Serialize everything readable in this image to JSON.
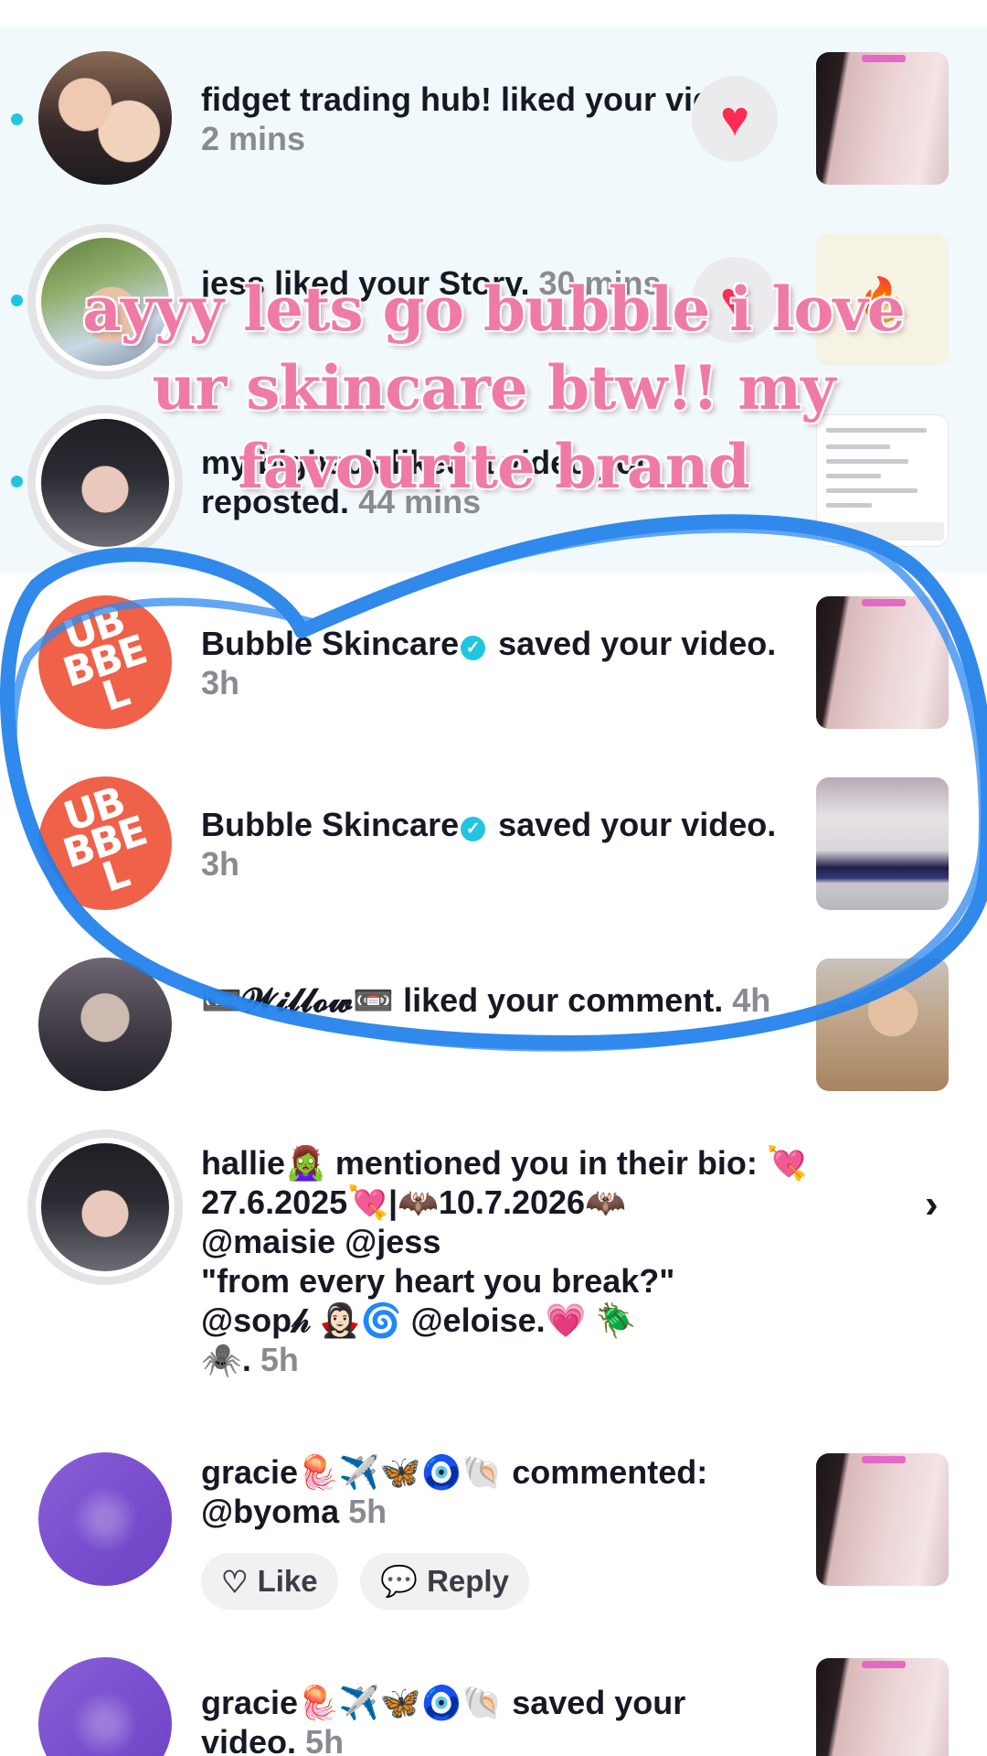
{
  "notifications": [
    {
      "user": "fidget trading hub!",
      "action": " liked your video.",
      "time": "2 mins",
      "unread": true,
      "avatar": "photo-two-girls",
      "trailing": "heart-button",
      "thumbnail": "skin-video"
    },
    {
      "user": "jess",
      "action": " liked your Story.",
      "time": "30 mins",
      "unread": true,
      "avatar": "photo-girl-outdoors",
      "trailing": "heart-button",
      "thumbnail": "story-sticker"
    },
    {
      "user": "my bigback",
      "action": " liked a video you reposted.",
      "time": "44 mins",
      "unread": true,
      "avatar": "photo-girl-sunglasses",
      "thumbnail": "notes-list"
    },
    {
      "user": "Bubble Skincare",
      "verified": true,
      "action": " saved your video.",
      "time": "3h",
      "avatar": "bubble-logo",
      "thumbnail": "skin-video"
    },
    {
      "user": "Bubble Skincare",
      "verified": true,
      "action": " saved your video.",
      "time": "3h",
      "avatar": "bubble-logo",
      "thumbnail": "room-video"
    },
    {
      "user": "📼𝓦𝓲𝓵𝓵𝓸𝔀📼",
      "action": " liked your comment.",
      "time": "4h",
      "avatar": "photo-willow",
      "thumbnail": "girl-photo"
    },
    {
      "user": "hallie🧟‍♀️",
      "action": " mentioned you in their bio:",
      "bio_lines": [
        "💘",
        "27.6.2025💘|🦇10.7.2026🦇",
        "@maisie @jess",
        "\"from every heart you break?\"",
        "@sop𝒽 🧛🏻‍♀️🌀 @eloise.💗 🪲",
        "🕷️."
      ],
      "time": "5h",
      "avatar": "photo-girl-sunglasses"
    },
    {
      "user": "gracie🪼✈️🦋🧿🐚",
      "action": " commented: @byoma",
      "time": "5h",
      "avatar": "purple-sparkle",
      "thumbnail": "skin-video",
      "like_label": "Like",
      "reply_label": "Reply"
    },
    {
      "user": "gracie🪼✈️🦋🧿🐚",
      "action": " saved your video.",
      "time": "5h",
      "avatar": "purple-sparkle",
      "thumbnail": "skin-video"
    }
  ],
  "logo": {
    "line1": "UB",
    "line2": "BBE",
    "line3": "L"
  },
  "overlay": {
    "text": "ayyy lets go bubble i love ur skincare btw!! my favourite brand",
    "color": "#f07aa6"
  },
  "annotation": {
    "type": "hand-drawn circle",
    "color": "#1f7fe8"
  },
  "colors": {
    "unread_bg": "#f1f9fc",
    "unread_dot": "#20c6e0",
    "like_heart": "#fe2c55",
    "verified": "#20c6e0",
    "timestamp": "#8a8b91"
  }
}
